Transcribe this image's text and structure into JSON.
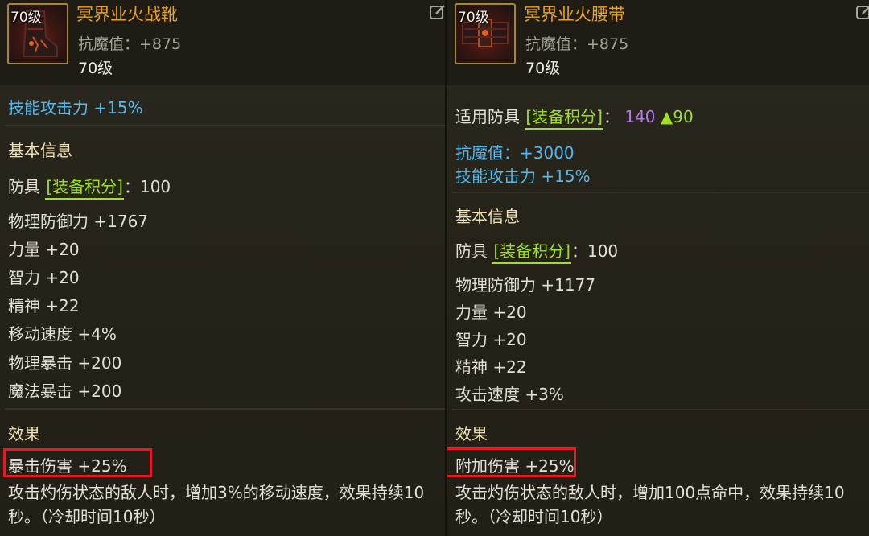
{
  "left": {
    "icon_level": "70级",
    "name": "冥界业火战靴",
    "magic_resist": "抗魔值：+875",
    "level": "70级",
    "skill_attack": "技能攻击力 +15%",
    "basic_info_heading": "基本信息",
    "armor_label": "防具",
    "score_tag": "[装备积分]",
    "score_value": "：100",
    "stats": [
      "物理防御力 +1767",
      "力量 +20",
      "智力 +20",
      "精神 +22",
      "移动速度 +4%",
      "物理暴击 +200",
      "魔法暴击 +200"
    ],
    "effect_heading": "效果",
    "effect_highlight": "暴击伤害 +25%",
    "effect_desc": "攻击灼伤状态的敌人时，增加3%的移动速度，效果持续10秒。（冷却时间10秒）"
  },
  "right": {
    "icon_level": "70级",
    "name": "冥界业火腰带",
    "magic_resist": "抗魔值：+875",
    "level": "70级",
    "applicable_label": "适用防具",
    "score_tag": "[装备积分]",
    "applicable_colon": "：",
    "applicable_score": "140",
    "applicable_delta": "▲90",
    "magic_resist_bonus": "抗魔值：+3000",
    "skill_attack": "技能攻击力 +15%",
    "basic_info_heading": "基本信息",
    "armor_label": "防具",
    "score_value": "：100",
    "stats": [
      "物理防御力 +1177",
      "力量 +20",
      "智力 +20",
      "精神 +22",
      "攻击速度 +3%"
    ],
    "effect_heading": "效果",
    "effect_highlight": "附加伤害 +25%",
    "effect_desc": "攻击灼伤状态的敌人时，增加100点命中，效果持续10秒。（冷却时间10秒）"
  },
  "icons": {
    "edit": "edit-icon",
    "boots_art": "boots-item-icon",
    "belt_art": "belt-item-icon"
  },
  "colors": {
    "item_name": "#e8a21e",
    "bonus_blue": "#56b8ea",
    "tag_green": "#9ee21f",
    "score_purple": "#b778f4",
    "highlight_red": "#e41a24"
  }
}
